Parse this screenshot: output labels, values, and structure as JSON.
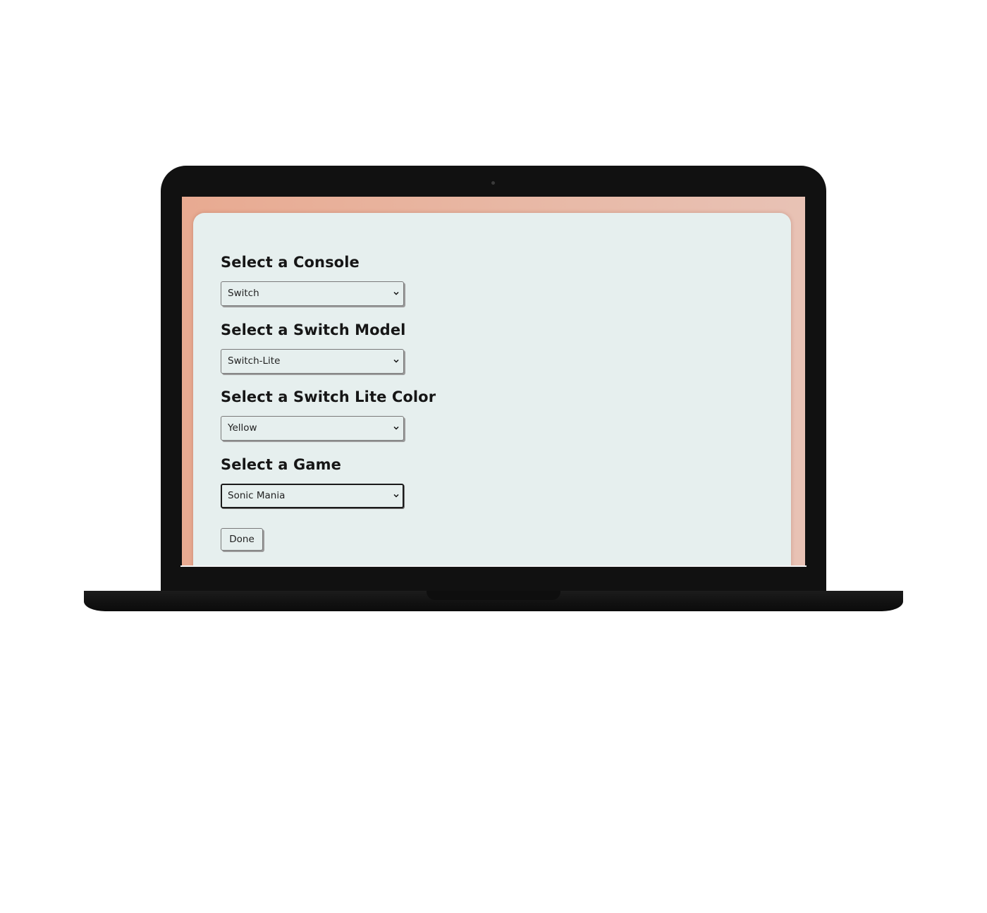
{
  "form": {
    "console": {
      "heading": "Select a Console",
      "selected": "Switch"
    },
    "model": {
      "heading": "Select a Switch Model",
      "selected": "Switch-Lite"
    },
    "color": {
      "heading": "Select a Switch Lite Color",
      "selected": "Yellow"
    },
    "game": {
      "heading": "Select a Game",
      "selected": "Sonic Mania"
    },
    "done_label": "Done"
  },
  "icons": {
    "dropdown": "chevron-down-icon"
  },
  "colors": {
    "card_background": "#e6efee",
    "page_background_start": "#e8aa91",
    "page_background_end": "#e8c2b5",
    "device_frame": "#111111",
    "text": "#161616"
  }
}
